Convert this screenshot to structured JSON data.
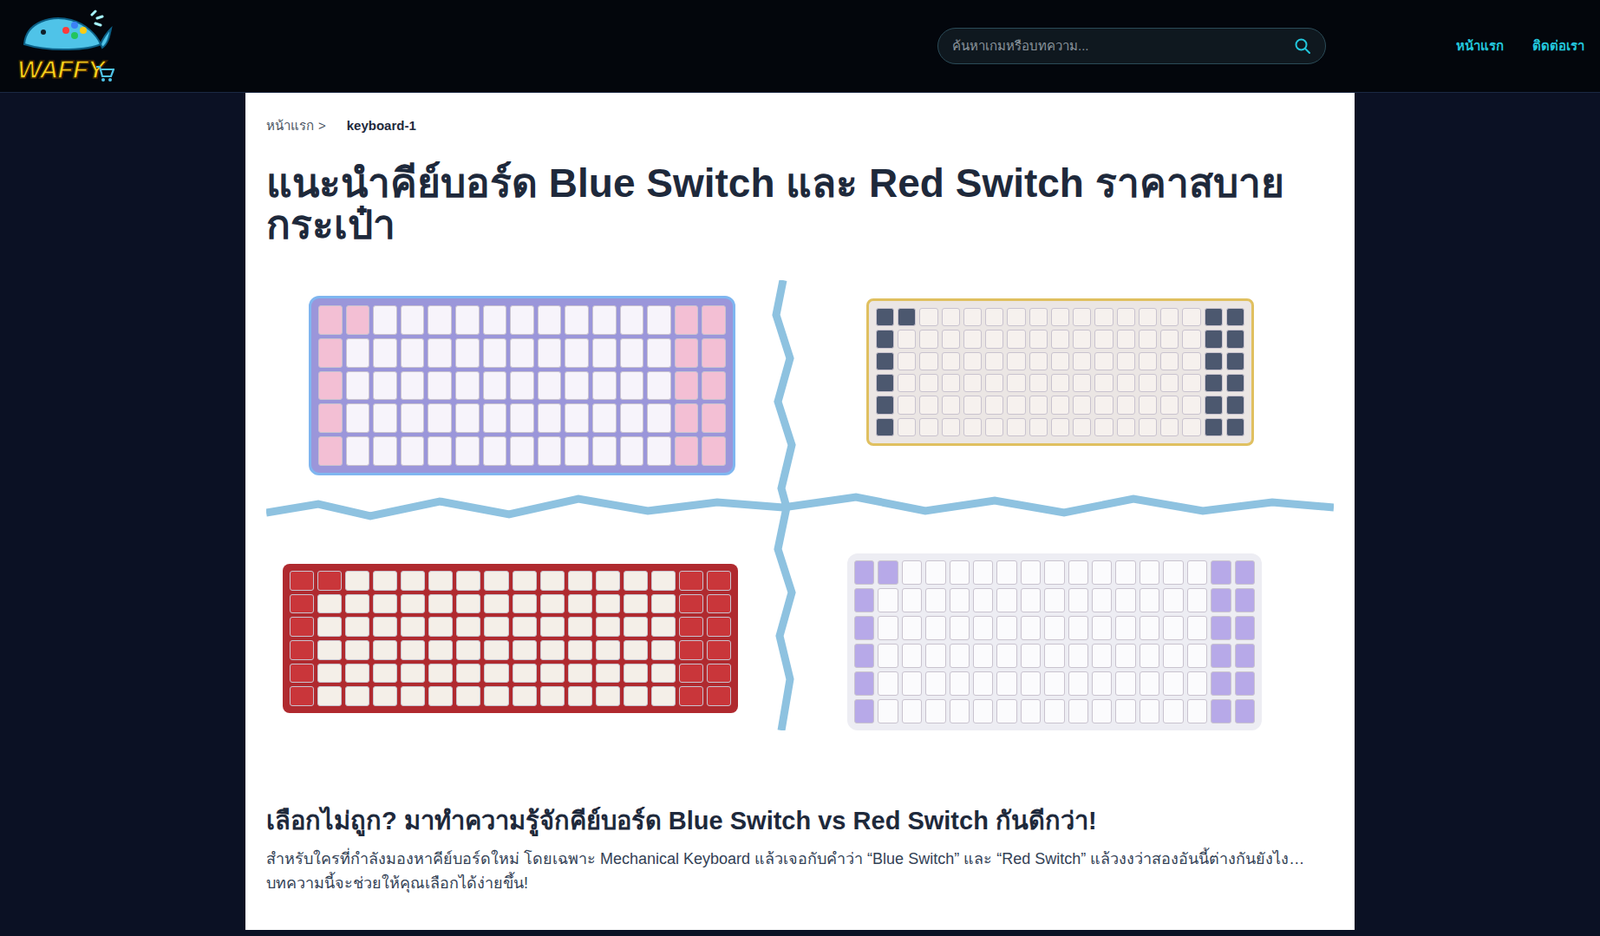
{
  "header": {
    "logo": "WAFFY",
    "search": {
      "placeholder": "ค้นหาเกมหรือบทความ..."
    },
    "nav": [
      {
        "label": "หน้าแรก"
      },
      {
        "label": "ติดต่อเรา"
      }
    ]
  },
  "breadcrumb": {
    "items": [
      {
        "label": "หน้าแรก"
      },
      {
        "label": "keyboard-1"
      }
    ],
    "separator": ">"
  },
  "article": {
    "title": "แนะนำคีย์บอร์ด Blue Switch และ Red Switch ราคาสบายกระเป๋า",
    "heading": "เลือกไม่ถูก? มาทำความรู้จักคีย์บอร์ด Blue Switch vs Red Switch กันดีกว่า!",
    "paragraph": "สำหรับใครที่กำลังมองหาคีย์บอร์ดใหม่ โดยเฉพาะ Mechanical Keyboard แล้วเจอกับคำว่า “Blue Switch” และ “Red Switch” แล้วงงว่าสองอันนี้ต่างกันยังไง… บทความนี้จะช่วยให้คุณเลือกได้ง่ายขึ้น!"
  }
}
